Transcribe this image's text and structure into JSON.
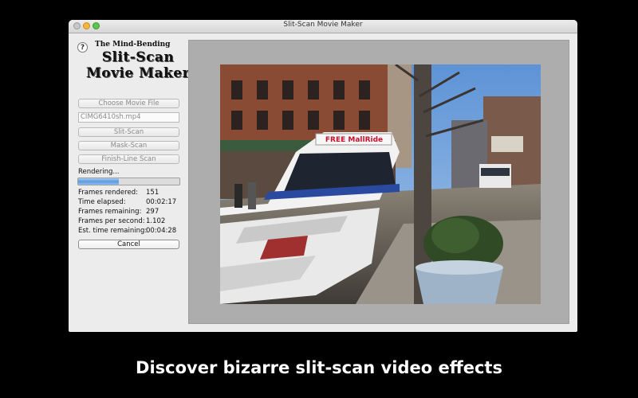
{
  "window": {
    "title": "Slit-Scan Movie Maker"
  },
  "sidebar": {
    "help_label": "?",
    "logo": {
      "line1": "The Mind-Bending",
      "line2": "Slit-Scan",
      "line3": "Movie Maker"
    },
    "choose_button": "Choose Movie File",
    "file_name": "CIMG6410sh.mp4",
    "slit_scan_button": "Slit-Scan",
    "mask_scan_button": "Mask-Scan",
    "finish_line_button": "Finish-Line Scan",
    "status": "Rendering...",
    "progress": 0.4,
    "stats": [
      {
        "label": "Frames rendered:",
        "value": "151"
      },
      {
        "label": "Time elapsed:",
        "value": "00:02:17"
      },
      {
        "label": "Frames remaining:",
        "value": "297"
      },
      {
        "label": "Frames per second:",
        "value": "1.102"
      },
      {
        "label": "Est. time remaining:",
        "value": "00:04:28"
      }
    ],
    "cancel_button": "Cancel"
  },
  "preview": {
    "bus_sign": "FREE MallRide"
  },
  "caption": "Discover bizarre slit-scan video effects"
}
